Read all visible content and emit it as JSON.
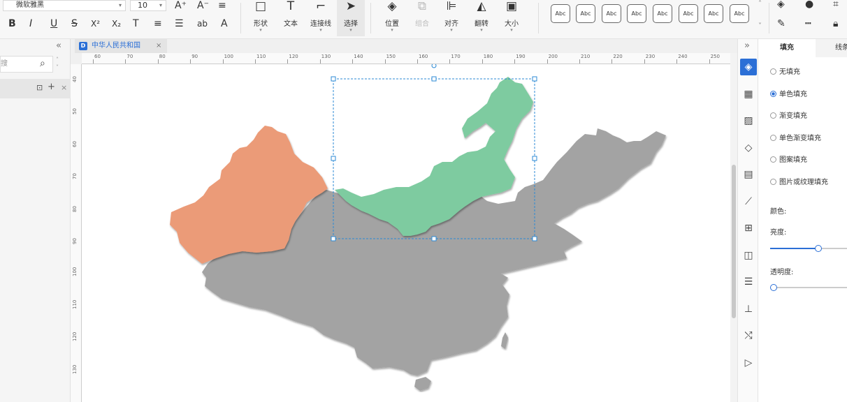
{
  "toolbar": {
    "font_family": "微软雅黑",
    "font_size": "10",
    "buttons": [
      {
        "label": "形状",
        "icon": "square-icon"
      },
      {
        "label": "文本",
        "icon": "text-icon"
      },
      {
        "label": "连接线",
        "icon": "connector-icon"
      },
      {
        "label": "选择",
        "icon": "cursor-icon"
      },
      {
        "label": "位置",
        "icon": "layers-icon"
      },
      {
        "label": "组合",
        "icon": "group-icon"
      },
      {
        "label": "对齐",
        "icon": "align-icon"
      },
      {
        "label": "翻转",
        "icon": "flip-icon"
      },
      {
        "label": "大小",
        "icon": "size-icon"
      }
    ],
    "style_preview_label": "Abc",
    "format_icons": {
      "bold": "B",
      "italic": "I",
      "underline": "U",
      "strike": "S",
      "superscript": "X²",
      "subscript": "X₂",
      "clear_format": "T",
      "line_spacing": "≡",
      "bullets": "☰",
      "text_case": "ab",
      "font_color": "A",
      "grow": "A⁺",
      "shrink": "A⁻",
      "align": "≡"
    }
  },
  "left_panel": {
    "search_placeholder": "搜",
    "collapse_glyph": "«"
  },
  "tabs": [
    {
      "label": "中华人民共和国",
      "close": "×"
    }
  ],
  "ruler": {
    "h_labels": [
      "60",
      "70",
      "80",
      "90",
      "100",
      "110",
      "120",
      "130",
      "140",
      "150",
      "160",
      "170",
      "180",
      "190",
      "200",
      "210",
      "220",
      "230",
      "240",
      "250"
    ],
    "v_labels": [
      "40",
      "50",
      "60",
      "70",
      "80",
      "90",
      "100",
      "110",
      "120",
      "130"
    ]
  },
  "rail_icons": [
    "fill-icon",
    "grid-icon",
    "image-icon",
    "layers-icon",
    "page-icon",
    "chart-icon",
    "table-icon",
    "shapes-icon",
    "list-icon",
    "org-chart-icon",
    "shuffle-icon",
    "present-icon"
  ],
  "properties": {
    "tabs": [
      "填充",
      "线条"
    ],
    "fill_options": [
      {
        "label": "无填充",
        "checked": false
      },
      {
        "label": "单色填充",
        "checked": true
      },
      {
        "label": "渐变填充",
        "checked": false
      },
      {
        "label": "单色渐变填充",
        "checked": false
      },
      {
        "label": "图案填充",
        "checked": false
      },
      {
        "label": "图片或纹理填充",
        "checked": false
      }
    ],
    "color_label": "颜色:",
    "brightness_label": "亮度:",
    "brightness_value": 0.62,
    "opacity_label": "透明度:",
    "opacity_value": 0.0
  },
  "colors": {
    "accent": "#2b6fd6",
    "map_gray": "#a3a3a3",
    "xinjiang": "#eb9b78",
    "inner_mongolia": "#7ecba0"
  }
}
